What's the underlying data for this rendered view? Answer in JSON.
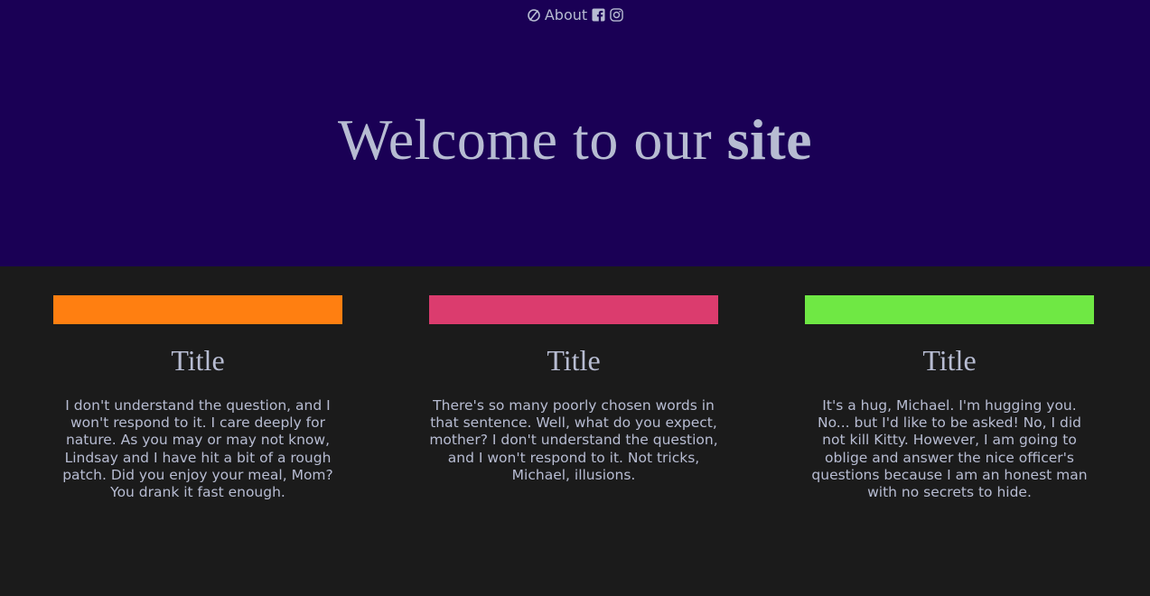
{
  "nav": {
    "about_label": "About",
    "icons": [
      "no-symbol-icon",
      "facebook-icon",
      "instagram-icon"
    ]
  },
  "hero": {
    "title_regular": "Welcome to our ",
    "title_bold": "site",
    "background": "#1a0055",
    "text_color": "#b7bcd2"
  },
  "cards": [
    {
      "accent": "#ff7f11",
      "title": "Title",
      "body": "I don't understand the question, and I won't respond to it. I care deeply for nature. As you may or may not know, Lindsay and I have hit a bit of a rough patch. Did you enjoy your meal, Mom? You drank it fast enough."
    },
    {
      "accent": "#db3c6e",
      "title": "Title",
      "body": "There's so many poorly chosen words in that sentence. Well, what do you expect, mother? I don't understand the question, and I won't respond to it. Not tricks, Michael, illusions."
    },
    {
      "accent": "#6fe844",
      "title": "Title",
      "body": "It's a hug, Michael. I'm hugging you. No... but I'd like to be asked! No, I did not kill Kitty. However, I am going to oblige and answer the nice officer's questions because I am an honest man with no secrets to hide."
    }
  ]
}
